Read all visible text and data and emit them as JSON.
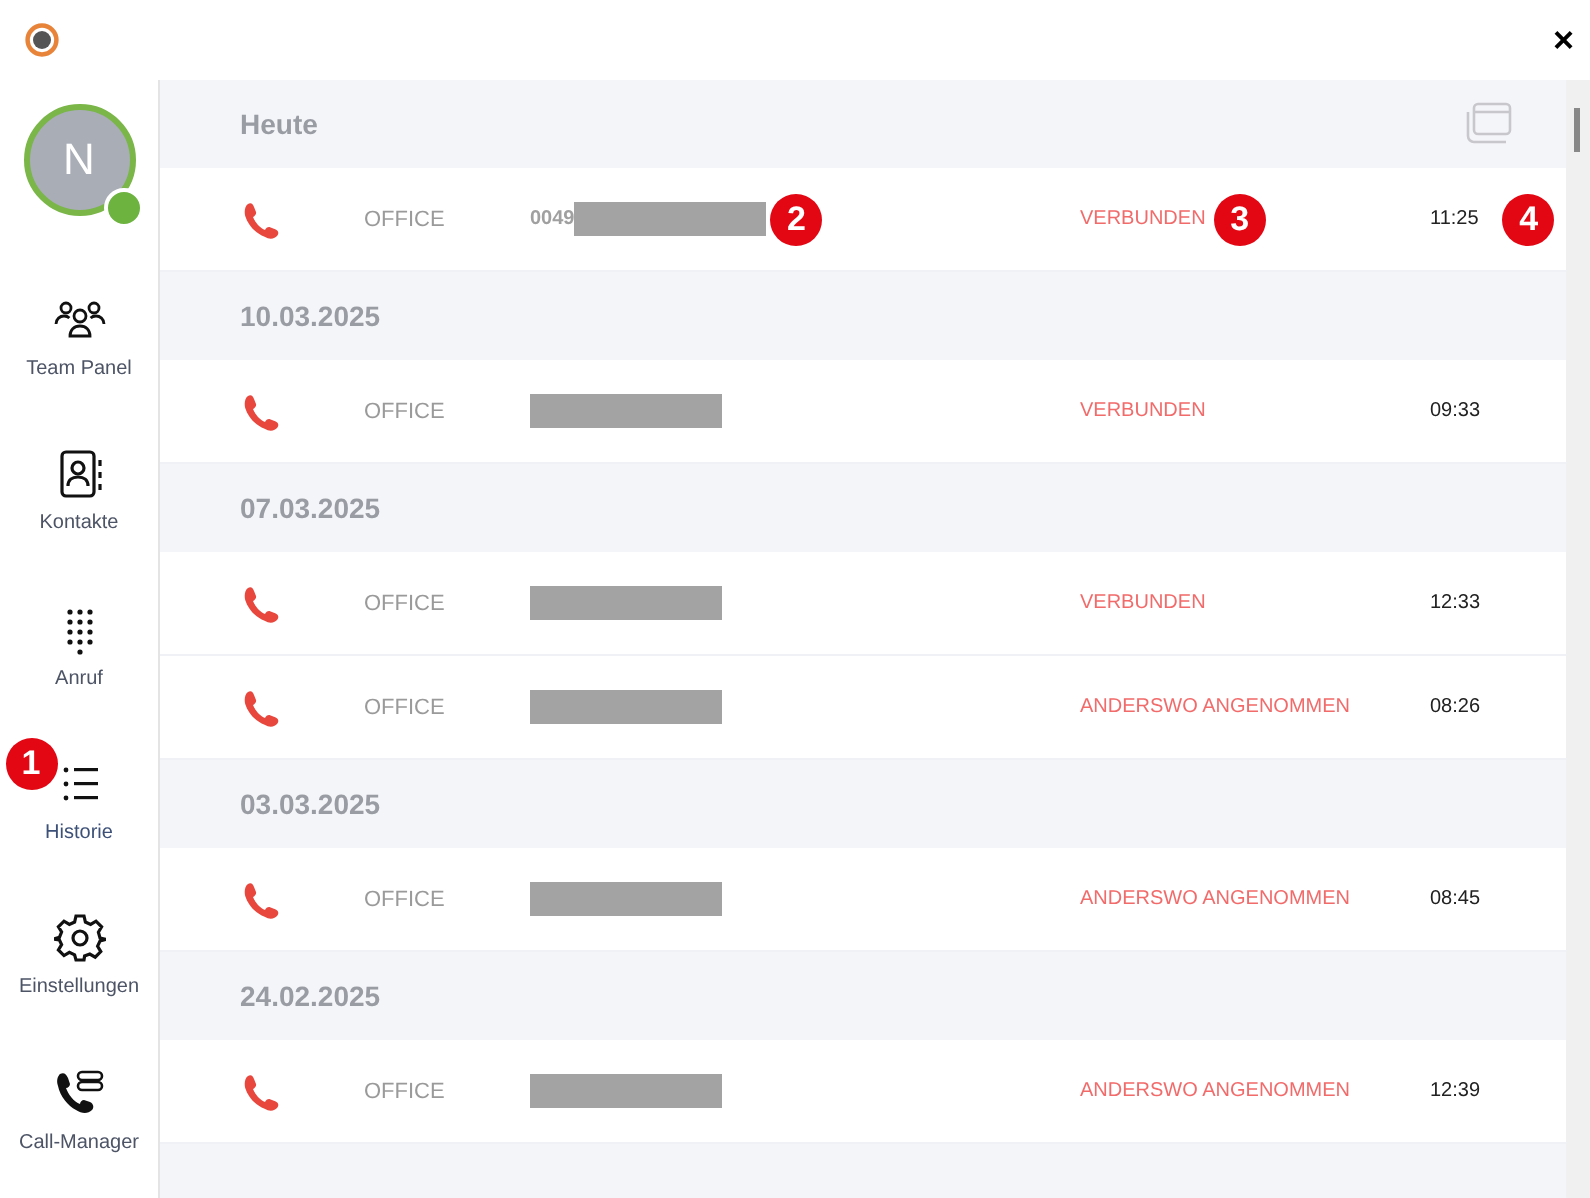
{
  "close_symbol": "×",
  "user": {
    "initial": "N",
    "online": true
  },
  "nav": [
    {
      "kind": "team",
      "label": "Team Panel",
      "selected": false
    },
    {
      "kind": "contacts",
      "label": "Kontakte",
      "selected": false
    },
    {
      "kind": "dialpad",
      "label": "Anruf",
      "selected": false
    },
    {
      "kind": "history",
      "label": "Historie",
      "selected": true,
      "callout": "1"
    },
    {
      "kind": "settings",
      "label": "Einstellungen",
      "selected": false
    },
    {
      "kind": "callmanager",
      "label": "Call-Manager",
      "selected": false
    }
  ],
  "groups": [
    {
      "date": "Heute",
      "calls": [
        {
          "line": "OFFICE",
          "number": "0049",
          "redacted": true,
          "status": "VERBUNDEN",
          "time": "11:25",
          "number_callout": "2",
          "status_callout": "3",
          "time_callout": "4"
        }
      ]
    },
    {
      "date": "10.03.2025",
      "calls": [
        {
          "line": "OFFICE",
          "redacted": true,
          "status": "VERBUNDEN",
          "time": "09:33"
        }
      ]
    },
    {
      "date": "07.03.2025",
      "calls": [
        {
          "line": "OFFICE",
          "redacted": true,
          "status": "VERBUNDEN",
          "time": "12:33"
        },
        {
          "line": "OFFICE",
          "redacted": true,
          "status": "ANDERSWO ANGENOMMEN",
          "time": "08:26"
        }
      ]
    },
    {
      "date": "03.03.2025",
      "calls": [
        {
          "line": "OFFICE",
          "redacted": true,
          "status": "ANDERSWO ANGENOMMEN",
          "time": "08:45"
        }
      ]
    },
    {
      "date": "24.02.2025",
      "calls": [
        {
          "line": "OFFICE",
          "redacted": true,
          "status": "ANDERSWO ANGENOMMEN",
          "time": "12:39"
        }
      ]
    }
  ]
}
